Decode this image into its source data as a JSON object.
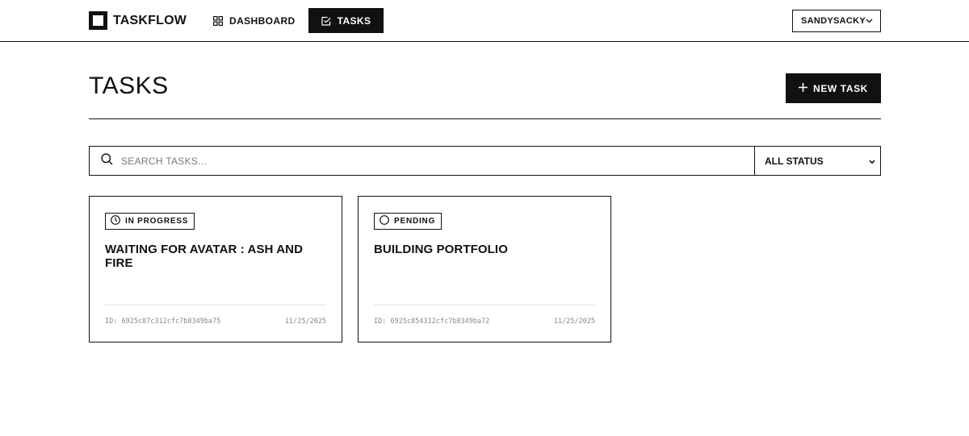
{
  "app": {
    "name": "TASKFLOW"
  },
  "nav": {
    "items": [
      {
        "label": "DASHBOARD",
        "icon": "dashboard-grid-icon",
        "active": false
      },
      {
        "label": "TASKS",
        "icon": "checkbox-icon",
        "active": true
      }
    ]
  },
  "user": {
    "name": "SANDYSACKY",
    "icon": "chevron-down-icon"
  },
  "page": {
    "title": "TASKS",
    "new_task_label": "NEW TASK"
  },
  "filters": {
    "search_placeholder": "SEARCH TASKS...",
    "search_value": "",
    "status_selected": "ALL STATUS"
  },
  "tasks": [
    {
      "status": "IN PROGRESS",
      "status_icon": "clock-icon",
      "title": "WAITING FOR AVATAR : ASH AND FIRE",
      "id_text": "ID: 6925c87c312cfc7b8349ba75",
      "date": "11/25/2025"
    },
    {
      "status": "PENDING",
      "status_icon": "circle-icon",
      "title": "BUILDING PORTFOLIO",
      "id_text": "ID: 6925c854312cfc7b8349ba72",
      "date": "11/25/2025"
    }
  ],
  "colors": {
    "primary": "#111111",
    "background": "#ffffff",
    "muted": "#888888",
    "divider": "#e2e2e2"
  }
}
